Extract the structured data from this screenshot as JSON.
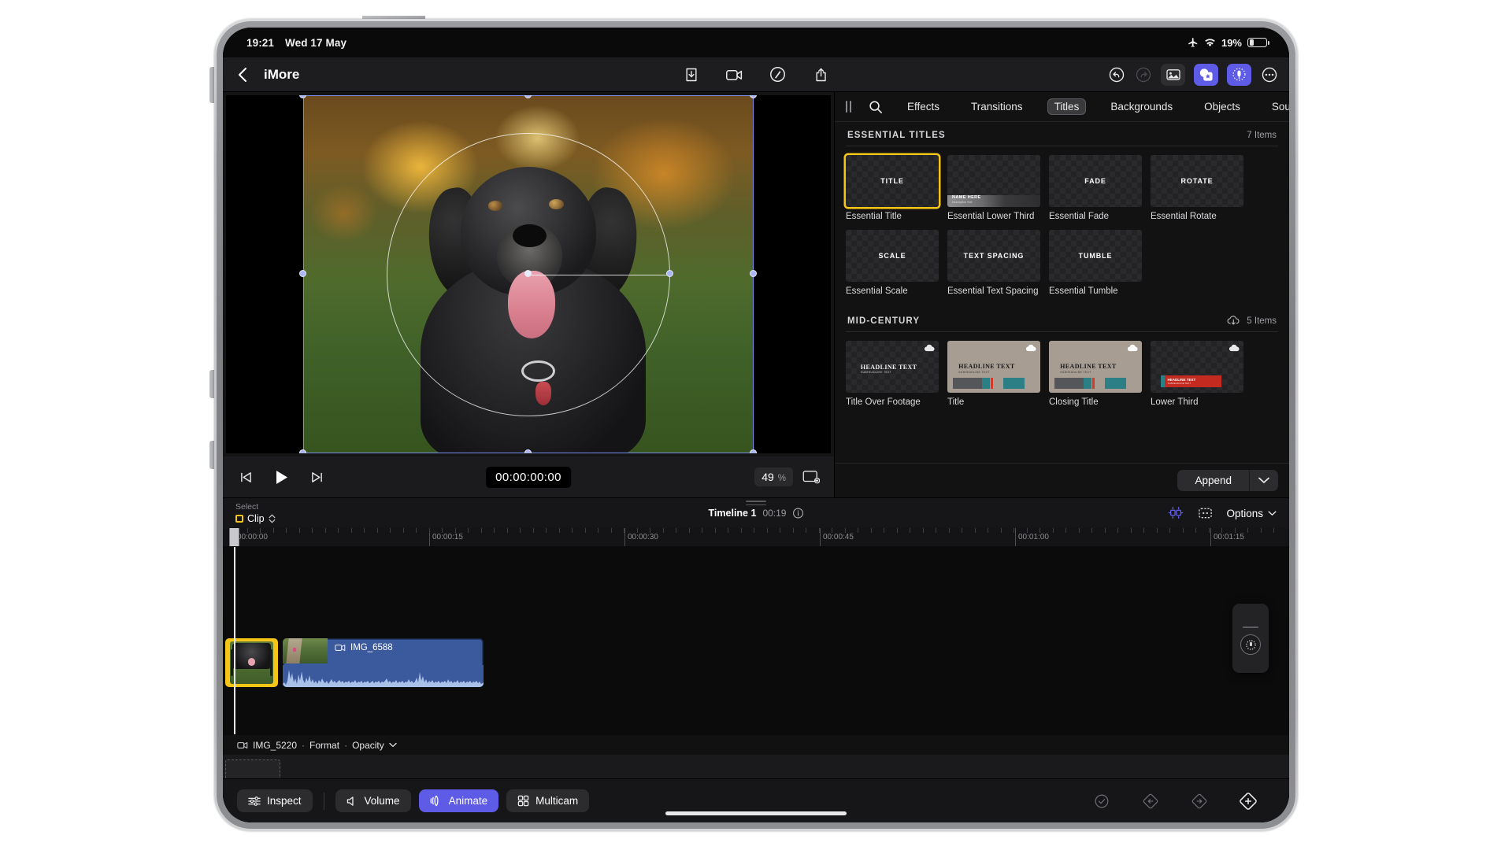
{
  "status_bar": {
    "time": "19:21",
    "date": "Wed 17 May",
    "battery_percent": "19%",
    "icons": [
      "airplane-icon",
      "wifi-icon",
      "battery-icon"
    ]
  },
  "nav": {
    "back_label": "chevron-left-icon",
    "project_title": "iMore",
    "center_icons": [
      "import-icon",
      "record-video-icon",
      "enhance-magic-icon",
      "share-icon"
    ],
    "right_icons": [
      "undo-icon",
      "redo-icon",
      "media-browser-icon",
      "effects-browser-icon",
      "audio-browser-icon",
      "more-options-icon"
    ]
  },
  "viewer": {
    "transport": {
      "skip_back": "skip-to-start-icon",
      "play": "play-icon",
      "skip_forward": "skip-to-end-icon",
      "timecode": "00:00:00:00",
      "zoom_value": "49",
      "zoom_unit": "%",
      "fit_icon": "fit-to-screen-icon"
    }
  },
  "browser": {
    "grip": "panel-grip-handle",
    "search_icon": "search-icon",
    "tabs": [
      {
        "label": "Effects",
        "active": false
      },
      {
        "label": "Transitions",
        "active": false
      },
      {
        "label": "Titles",
        "active": true
      },
      {
        "label": "Backgrounds",
        "active": false
      },
      {
        "label": "Objects",
        "active": false
      },
      {
        "label": "Soundtracks",
        "active": false
      }
    ],
    "sections": [
      {
        "title": "ESSENTIAL TITLES",
        "count": "7 Items",
        "has_cloud": false,
        "items": [
          {
            "label": "Essential Title",
            "preview_text": "TITLE",
            "selected": true,
            "style": "checker"
          },
          {
            "label": "Essential Lower Third",
            "preview_text": "",
            "selected": false,
            "style": "lower-third"
          },
          {
            "label": "Essential Fade",
            "preview_text": "FADE",
            "selected": false,
            "style": "checker"
          },
          {
            "label": "Essential Rotate",
            "preview_text": "ROTATE",
            "selected": false,
            "style": "checker"
          },
          {
            "label": "Essential Scale",
            "preview_text": "SCALE",
            "selected": false,
            "style": "checker"
          },
          {
            "label": "Essential Text Spacing",
            "preview_text": "TEXT SPACING",
            "selected": false,
            "style": "checker"
          },
          {
            "label": "Essential Tumble",
            "preview_text": "TUMBLE",
            "selected": false,
            "style": "checker"
          }
        ]
      },
      {
        "title": "MID-CENTURY",
        "count": "5 Items",
        "has_cloud": true,
        "items": [
          {
            "label": "Title Over Footage",
            "headline": "HEADLINE TEXT",
            "subline": "SUBHEADLINE TEXT",
            "style": "overlay",
            "cloud": true
          },
          {
            "label": "Title",
            "headline": "HEADLINE TEXT",
            "subline": "SUBHEADLINE TEXT",
            "style": "midcentury",
            "cloud": true
          },
          {
            "label": "Closing Title",
            "headline": "HEADLINE TEXT",
            "subline": "SUBHEADLINE TEXT",
            "style": "midcentury",
            "cloud": true
          },
          {
            "label": "Lower Third",
            "headline": "HEADLINE TEXT",
            "subline": "SUBHEADLINE TEXT",
            "style": "lower-third-red",
            "cloud": true
          }
        ]
      }
    ],
    "footer": {
      "append_label": "Append",
      "caret_icon": "chevron-down-icon"
    }
  },
  "timeline": {
    "select_label": "Select",
    "select_value": "Clip",
    "select_caret": "updown-chevron-icon",
    "name": "Timeline 1",
    "duration": "00:19",
    "info_icon": "info-icon",
    "right_icons": [
      "trim-tool-icon",
      "clip-settings-icon"
    ],
    "options_label": "Options",
    "ruler_labels": [
      "00:00:00",
      "00:00:15",
      "00:00:30",
      "00:00:45",
      "00:01:00",
      "00:01:15"
    ],
    "clips": [
      {
        "name": "",
        "selected": true,
        "type": "video-thumbnail"
      },
      {
        "name": "IMG_6588",
        "selected": false,
        "type": "video-with-audio",
        "icon": "video-camera-icon"
      }
    ],
    "meta_bar": {
      "icon": "video-camera-icon",
      "clip_name": "IMG_5220",
      "separator": "·",
      "param1": "Format",
      "param2": "Opacity",
      "caret": "chevron-down-icon"
    }
  },
  "bottom_bar": {
    "buttons": [
      {
        "label": "Inspect",
        "icon": "sliders-icon",
        "active": false
      },
      {
        "label": "Volume",
        "icon": "speaker-icon",
        "active": false
      },
      {
        "label": "Animate",
        "icon": "animate-icon",
        "active": true
      },
      {
        "label": "Multicam",
        "icon": "grid-four-icon",
        "active": false
      }
    ],
    "keyframe_icons": [
      "keyframe-check-icon",
      "keyframe-previous-icon",
      "keyframe-next-icon",
      "keyframe-add-icon"
    ]
  },
  "colors": {
    "accent_purple": "#5e5ce6",
    "selection_yellow": "#f5c518",
    "clip_blue": "#3b5a9e"
  }
}
